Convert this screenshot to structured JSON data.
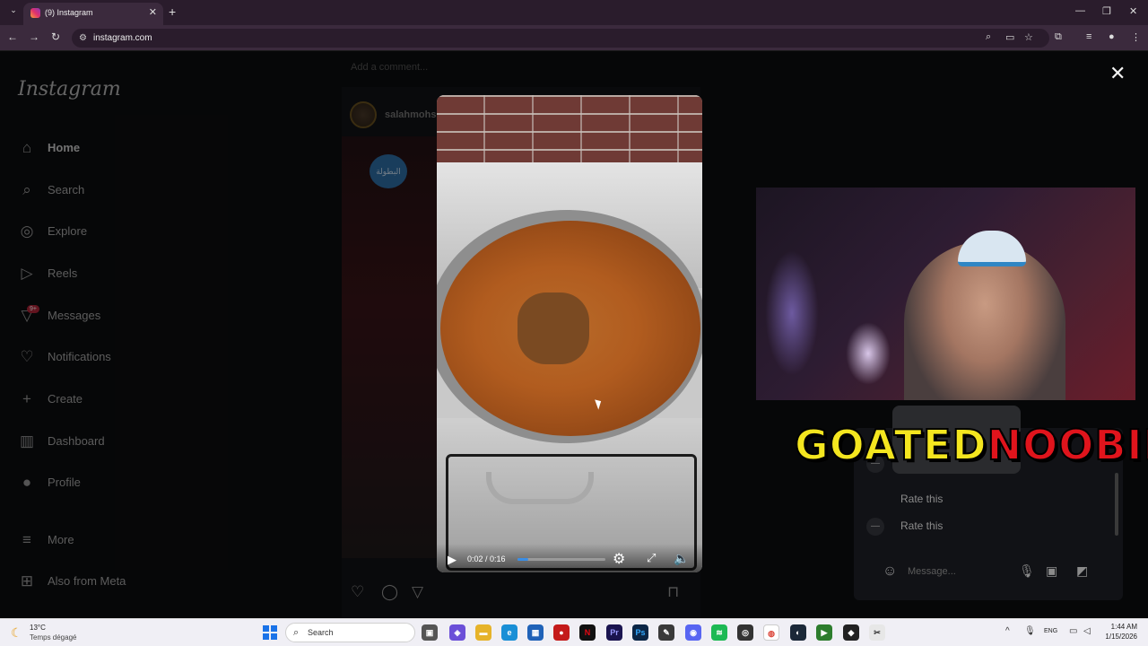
{
  "browser": {
    "tab_title": "(9) Instagram",
    "url": "instagram.com",
    "new_tab": "+",
    "window_controls": [
      "minimize",
      "restore",
      "close"
    ]
  },
  "instagram": {
    "logo": "Instagram",
    "nav": [
      {
        "label": "Home",
        "icon": "home-icon",
        "active": true
      },
      {
        "label": "Search",
        "icon": "search-icon"
      },
      {
        "label": "Explore",
        "icon": "compass-icon"
      },
      {
        "label": "Reels",
        "icon": "reels-icon"
      },
      {
        "label": "Messages",
        "icon": "messenger-icon"
      },
      {
        "label": "Notifications",
        "icon": "heart-icon"
      },
      {
        "label": "Create",
        "icon": "plus-icon"
      },
      {
        "label": "Dashboard",
        "icon": "dashboard-icon"
      },
      {
        "label": "Profile",
        "icon": "avatar-icon"
      },
      {
        "label": "More",
        "icon": "menu-icon"
      },
      {
        "label": "Also from Meta",
        "icon": "meta-grid-icon"
      }
    ],
    "messages_badge": "9+",
    "feed": {
      "add_comment_placeholder": "Add a comment...",
      "username": "salahmohs",
      "badge_text": "البطولة"
    }
  },
  "video_player": {
    "time": "0:02 / 0:16",
    "progress": 0.125,
    "close_label": "✕"
  },
  "dm_panel": {
    "rate_items": [
      "Rate this",
      "Rate this"
    ],
    "message_placeholder": "Message..."
  },
  "overlay_text": {
    "part1": "GOATED",
    "part2": "NOOBIE"
  },
  "taskbar": {
    "weather_temp": "13°C",
    "weather_desc": "Temps dégagé",
    "search_placeholder": "Search",
    "language": "ENG",
    "time": "1:44 AM",
    "date": "1/15/2026"
  },
  "colors": {
    "accent": "#3a8ee6",
    "badge_red": "#b3263a",
    "overlay_yellow": "#f4e61f",
    "overlay_red": "#e0141c"
  }
}
